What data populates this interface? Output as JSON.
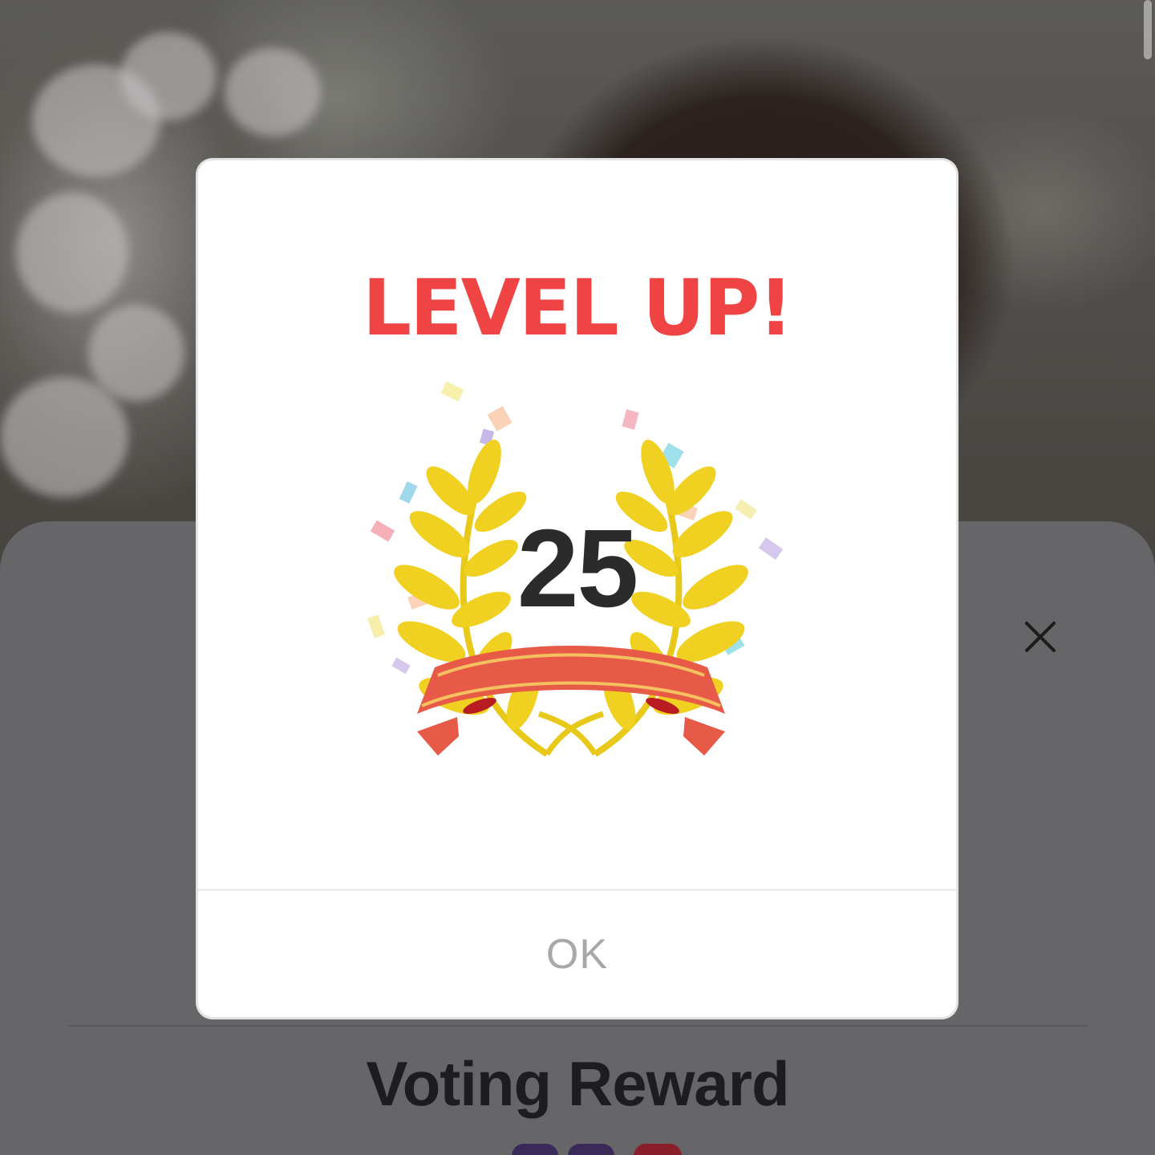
{
  "colors": {
    "title_red": "#f04444",
    "laurel_gold": "#f0d020",
    "ribbon_red": "#e85a48",
    "ok_text": "#a8a8a8",
    "sheet_dim": "#666568"
  },
  "modal": {
    "title": "LEVEL UP!",
    "level": "25",
    "ok_label": "OK",
    "icons": [
      "laurel-wreath-icon",
      "ribbon-banner-icon",
      "confetti-icon"
    ]
  },
  "sheet": {
    "reward_title": "Voting Reward",
    "close_icon": "close-icon"
  }
}
